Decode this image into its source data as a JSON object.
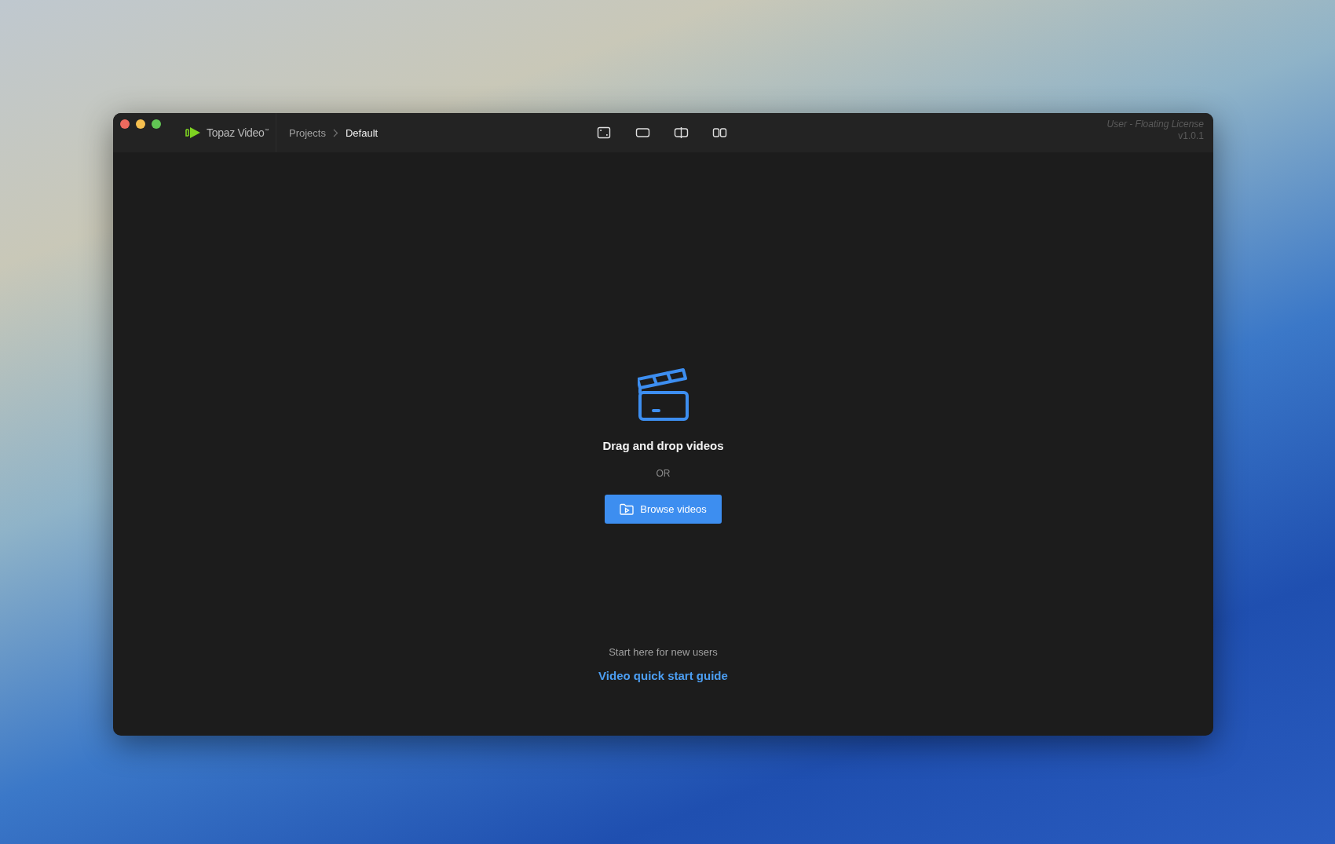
{
  "window": {
    "traffic_lights": [
      {
        "color": "#ed6a5e"
      },
      {
        "color": "#f5bf4f"
      },
      {
        "color": "#61c554"
      }
    ],
    "app_name": "Topaz Video$^{™}$",
    "breadcrumb": [
      {
        "label": "Projects",
        "current": false
      },
      {
        "label": "Default",
        "current": true
      }
    ],
    "view_modes": [
      {
        "kind": "fit"
      },
      {
        "kind": "single"
      },
      {
        "kind": "split"
      },
      {
        "kind": "side_by_side"
      }
    ],
    "license": {
      "user": "User - Floating License",
      "version": "v1.0.1"
    }
  },
  "drop_zone": {
    "title": "Drag and drop videos",
    "separator": "OR",
    "browse_button": "Browse videos",
    "hint": "Start here for new users",
    "link": "Video quick start guide"
  }
}
